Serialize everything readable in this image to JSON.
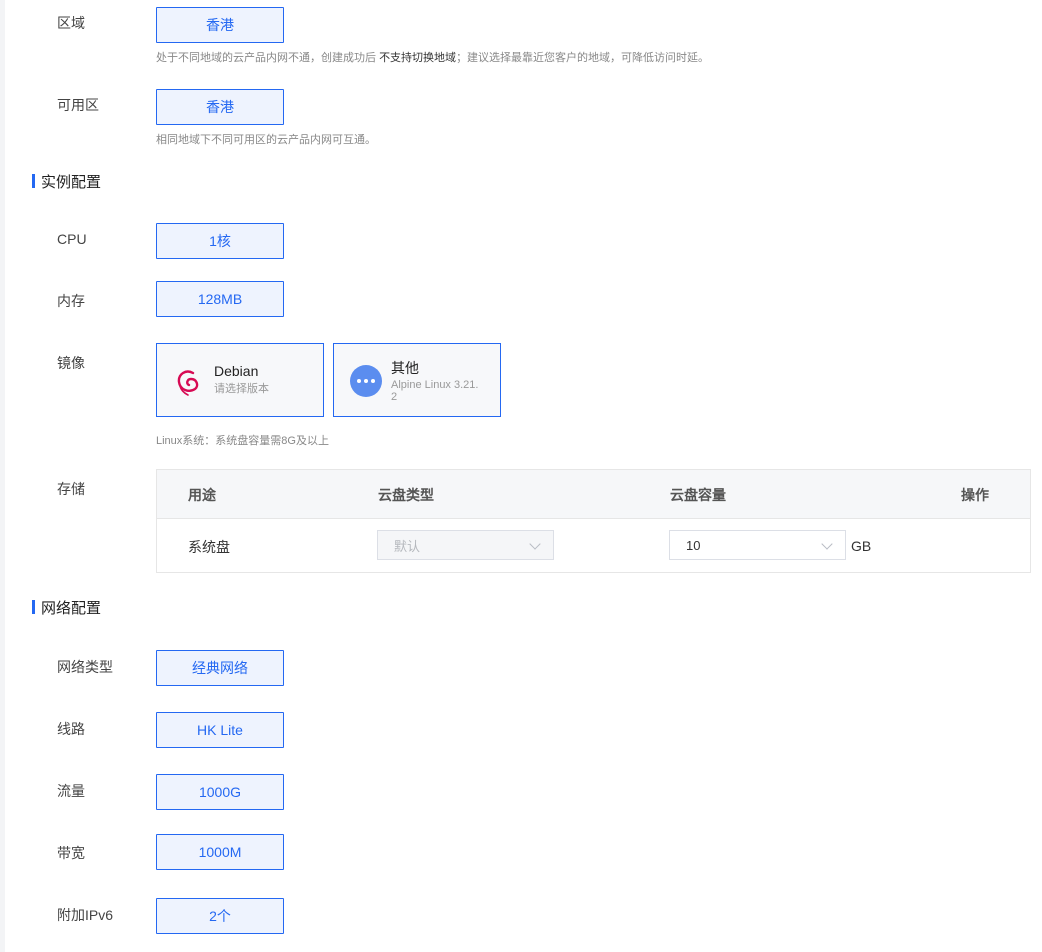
{
  "region": {
    "label": "区域",
    "value": "香港",
    "hint_pre": "处于不同地域的云产品内网不通，创建成功后 ",
    "hint_bold": "不支持切换地域",
    "hint_post": "；建议选择最靠近您客户的地域，可降低访问时延。"
  },
  "zone": {
    "label": "可用区",
    "value": "香港",
    "hint": "相同地域下不同可用区的云产品内网可互通。"
  },
  "instance_section": {
    "title": "实例配置"
  },
  "cpu": {
    "label": "CPU",
    "value": "1核"
  },
  "memory": {
    "label": "内存",
    "value": "128MB"
  },
  "image": {
    "label": "镜像",
    "cards": [
      {
        "name": "Debian",
        "sub": "请选择版本",
        "icon": "debian-logo-icon"
      },
      {
        "name": "其他",
        "sub_line1": "Alpine Linux 3.21.",
        "sub_line2": "2",
        "icon": "more-dots-icon"
      }
    ],
    "hint": "Linux系统：系统盘容量需8G及以上"
  },
  "storage": {
    "label": "存储",
    "headers": [
      "用途",
      "云盘类型",
      "云盘容量",
      "操作"
    ],
    "rows": [
      {
        "usage": "系统盘",
        "disk_type": "默认",
        "capacity": "10",
        "unit": "GB"
      }
    ]
  },
  "network_section": {
    "title": "网络配置"
  },
  "network_type": {
    "label": "网络类型",
    "value": "经典网络"
  },
  "line": {
    "label": "线路",
    "value": "HK Lite"
  },
  "traffic": {
    "label": "流量",
    "value": "1000G"
  },
  "bandwidth": {
    "label": "带宽",
    "value": "1000M"
  },
  "ipv6": {
    "label": "附加IPv6",
    "value": "2个"
  },
  "colors": {
    "accent": "#2468f2",
    "accent_bg": "#eef3fe",
    "debian_red": "#d70a53",
    "more_icon": "#5b8def"
  }
}
